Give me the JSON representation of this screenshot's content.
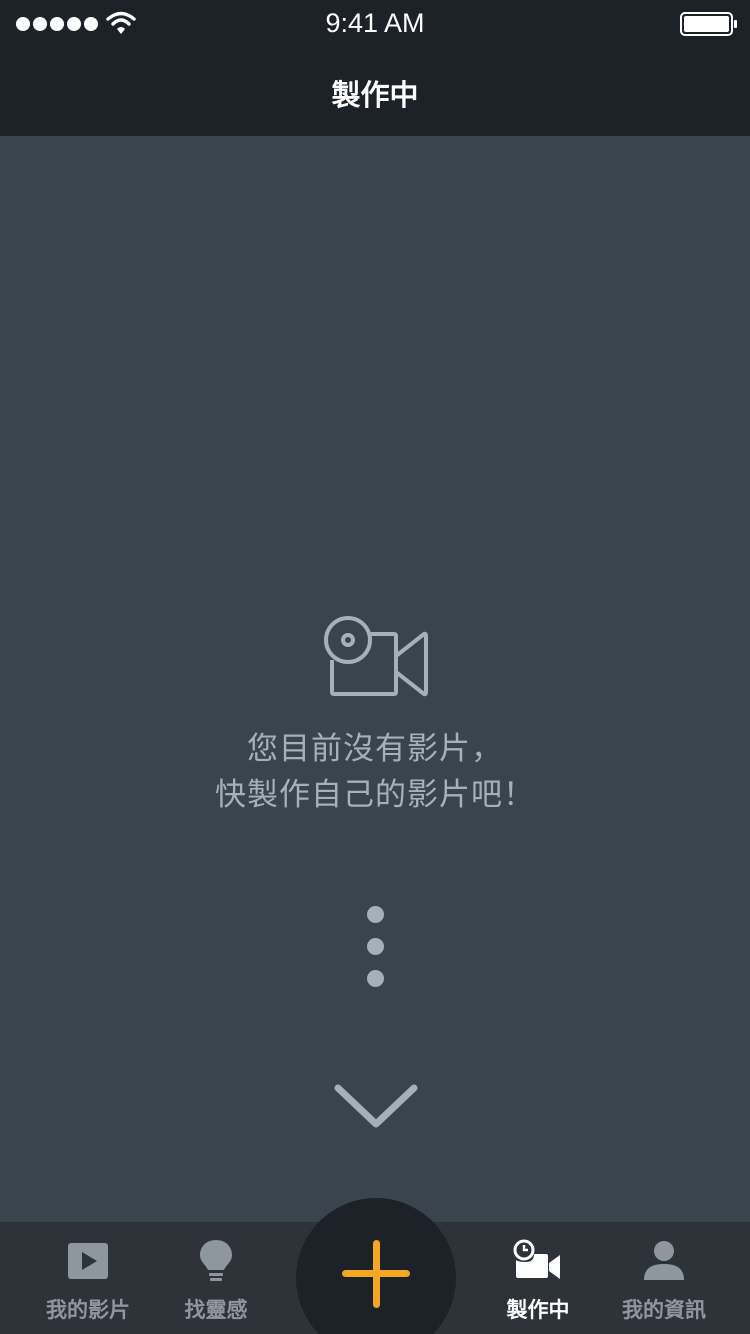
{
  "status_bar": {
    "time": "9:41 AM",
    "icons": [
      "signal-dots-icon",
      "wifi-icon",
      "battery-icon"
    ]
  },
  "nav": {
    "title": "製作中"
  },
  "empty_state": {
    "icon": "video-camera-icon",
    "line1": "您目前沒有影片，",
    "line2": "快製作自己的影片吧！",
    "more_icon": "vertical-dots-icon",
    "scroll_icon": "chevron-down-icon"
  },
  "tab_bar": {
    "tabs": [
      {
        "label": "我的影片",
        "icon": "play-video-icon",
        "active": false
      },
      {
        "label": "找靈感",
        "icon": "lightbulb-icon",
        "active": false
      },
      {
        "label": "製作中",
        "icon": "camera-clock-icon",
        "active": true
      },
      {
        "label": "我的資訊",
        "icon": "user-icon",
        "active": false
      }
    ],
    "fab_icon": "plus-icon"
  },
  "colors": {
    "background": "#3a444c",
    "bars": "#1c2228",
    "tab_bar": "#2d3338",
    "muted_text": "#a4b0ba",
    "accent": "#f5a623"
  }
}
